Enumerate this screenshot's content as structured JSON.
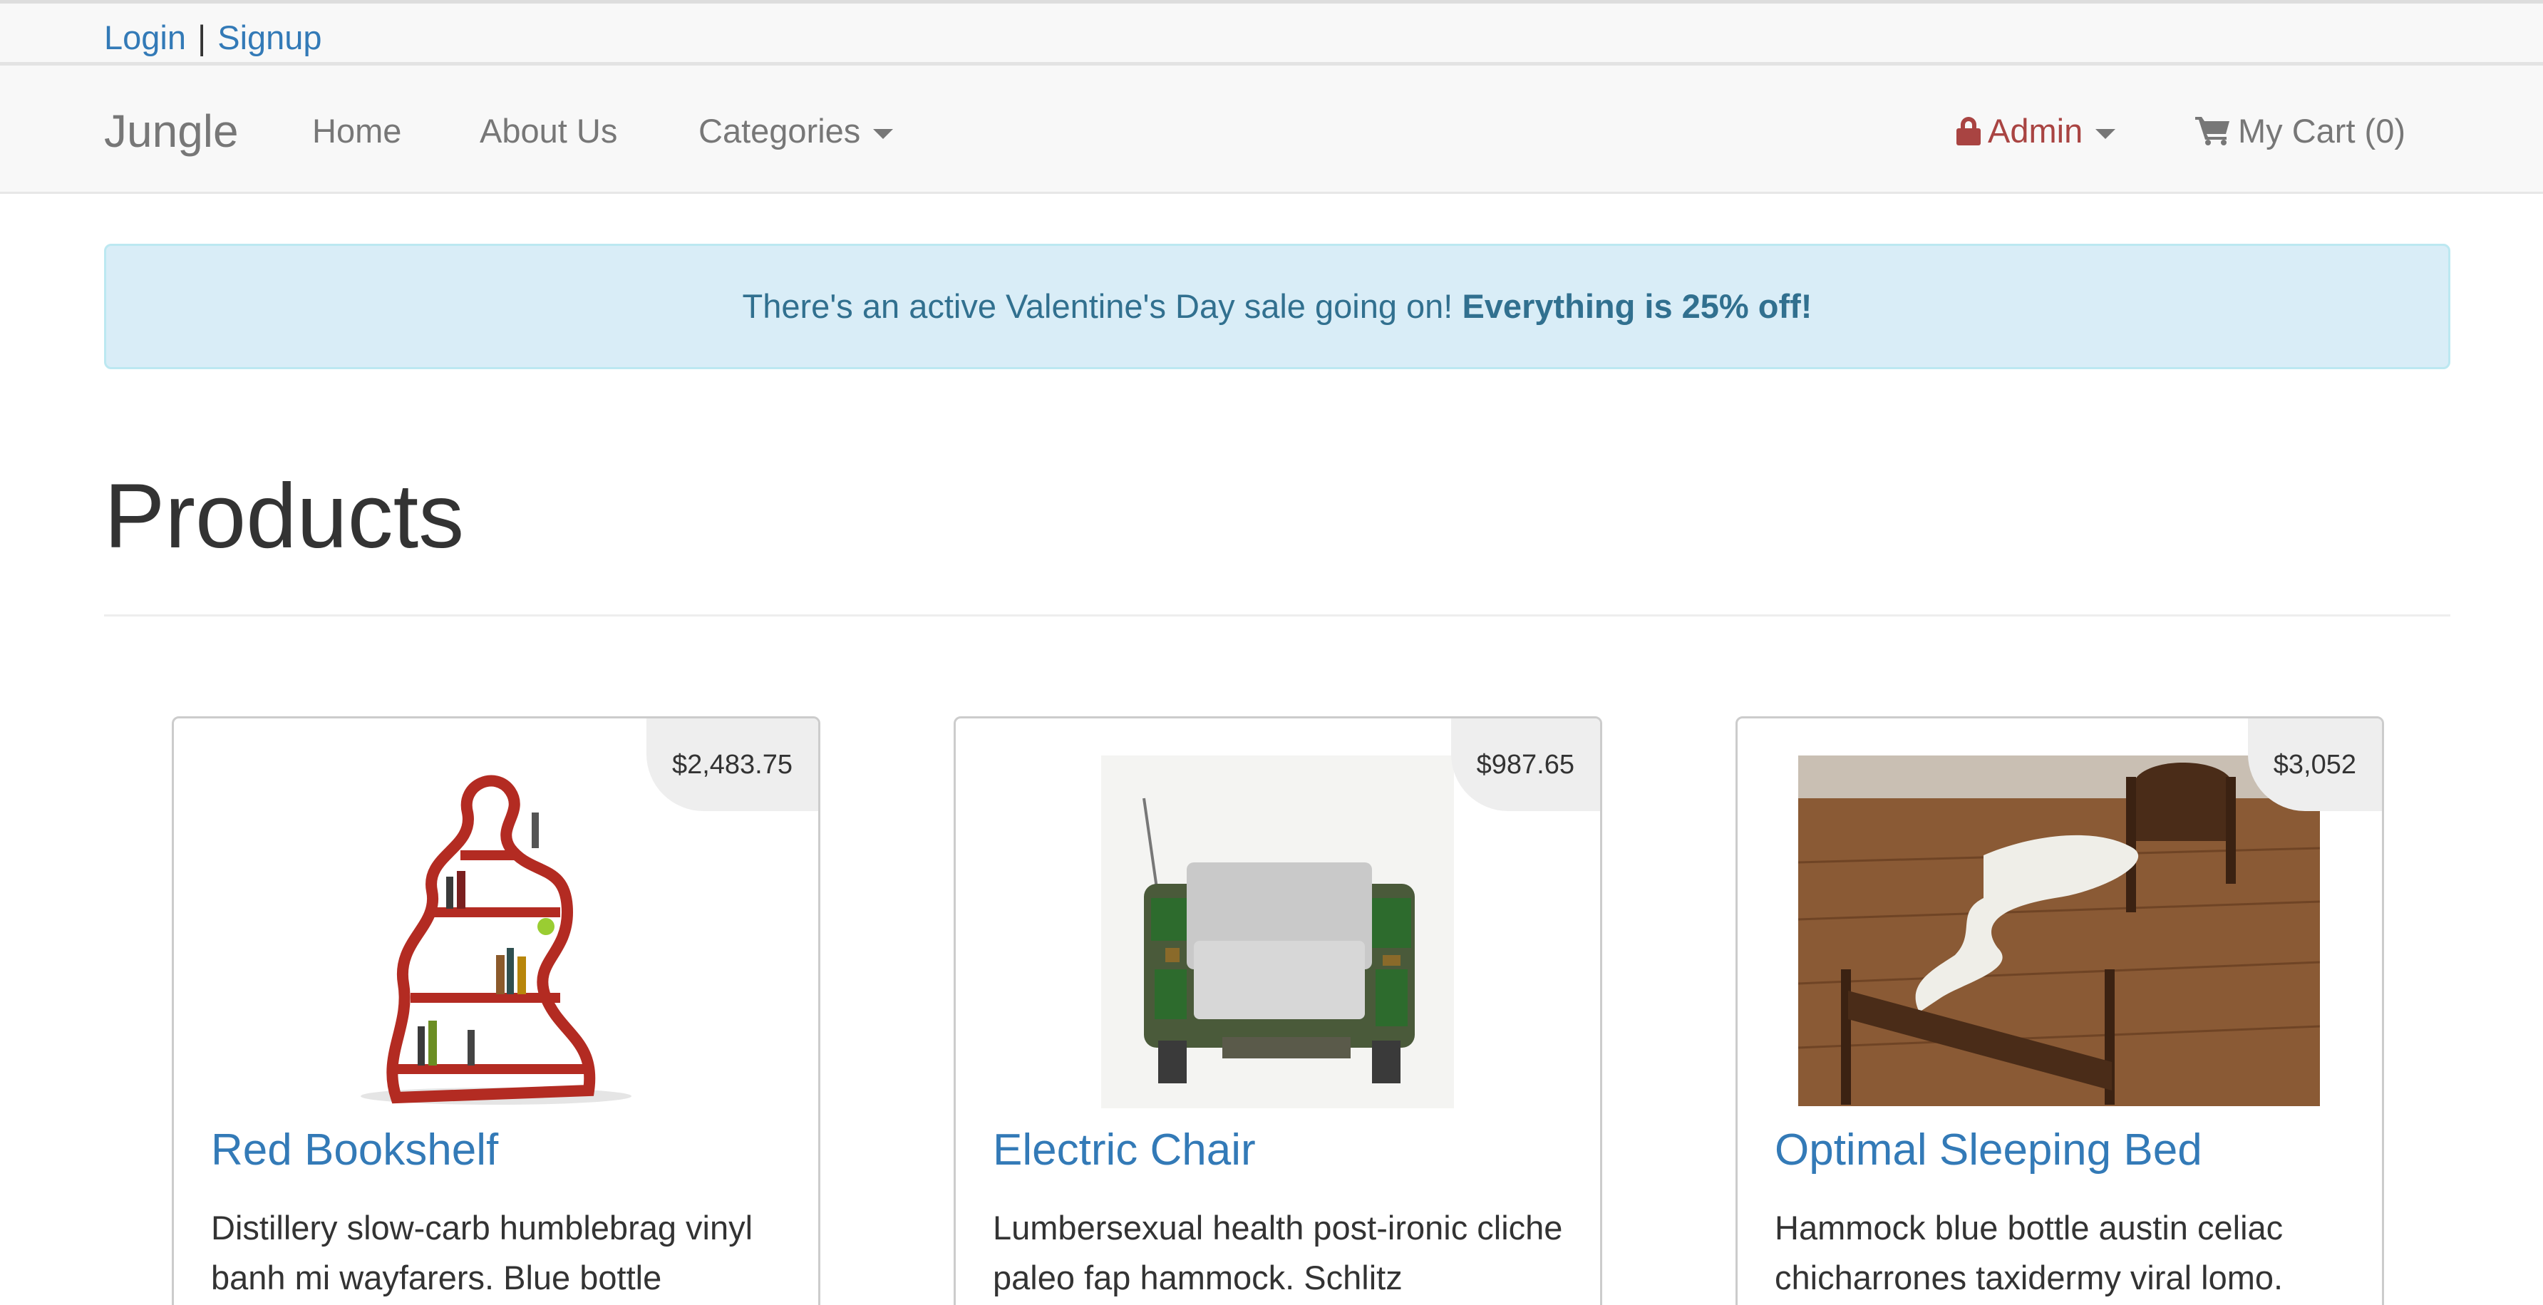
{
  "topbar": {
    "login": "Login",
    "separator": "|",
    "signup": "Signup"
  },
  "navbar": {
    "brand": "Jungle",
    "home": "Home",
    "about": "About Us",
    "categories": "Categories",
    "admin": "Admin",
    "cart": "My Cart (0)"
  },
  "alert": {
    "text": "There's an active Valentine's Day sale going on! ",
    "bold": "Everything is 25% off!"
  },
  "main": {
    "title": "Products"
  },
  "products": [
    {
      "name": "Red Bookshelf",
      "price": "$2,483.75",
      "description": "Distillery slow-carb humblebrag vinyl banh mi wayfarers. Blue bottle"
    },
    {
      "name": "Electric Chair",
      "price": "$987.65",
      "description": "Lumbersexual health post-ironic cliche paleo fap hammock. Schlitz"
    },
    {
      "name": "Optimal Sleeping Bed",
      "price": "$3,052",
      "description": "Hammock blue bottle austin celiac chicharrones taxidermy viral lomo."
    }
  ],
  "colors": {
    "link": "#337ab7",
    "admin": "#a94442",
    "alert_bg": "#d9edf7",
    "alert_text": "#31708f"
  }
}
